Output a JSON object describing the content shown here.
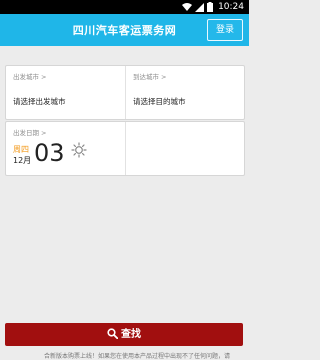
{
  "statusbar": {
    "time": "10:24"
  },
  "header": {
    "title": "四川汽车客运票务网",
    "login_label": "登录"
  },
  "route": {
    "from": {
      "label": "出发城市",
      "placeholder": "请选择出发城市"
    },
    "to": {
      "label": "到达城市",
      "placeholder": "请选择目的城市"
    }
  },
  "date": {
    "label": "出发日期",
    "weekday": "周四",
    "month": "12月",
    "day": "03"
  },
  "search": {
    "label": "查找"
  },
  "notice": {
    "text": "合新版本购票上线！如果您在使用本产品过程中出现不了任何问题，请"
  },
  "colors": {
    "accent": "#1fb6e8",
    "button": "#a10f0f",
    "weekday": "#f39a1c"
  },
  "icons": [
    "signal-icon",
    "wifi-icon",
    "battery-icon",
    "chevron-right-icon",
    "sun-icon",
    "search-icon"
  ]
}
